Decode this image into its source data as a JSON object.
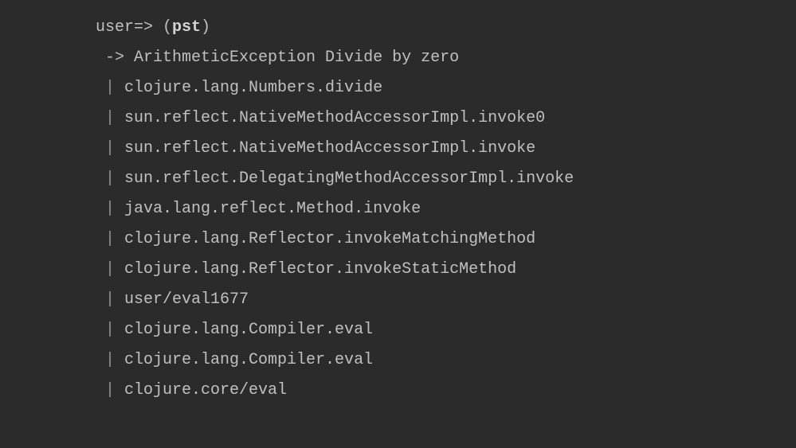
{
  "repl": {
    "prompt": "user=> ",
    "open_paren": "(",
    "fn": "pst",
    "close_paren": ")",
    "arrow": " -> ",
    "exception": "ArithmeticException Divide by zero",
    "pipe": " | ",
    "trace": [
      "clojure.lang.Numbers.divide",
      "sun.reflect.NativeMethodAccessorImpl.invoke0",
      "sun.reflect.NativeMethodAccessorImpl.invoke",
      "sun.reflect.DelegatingMethodAccessorImpl.invoke",
      "java.lang.reflect.Method.invoke",
      "clojure.lang.Reflector.invokeMatchingMethod",
      "clojure.lang.Reflector.invokeStaticMethod",
      "user/eval1677",
      "clojure.lang.Compiler.eval",
      "clojure.lang.Compiler.eval",
      "clojure.core/eval"
    ]
  }
}
